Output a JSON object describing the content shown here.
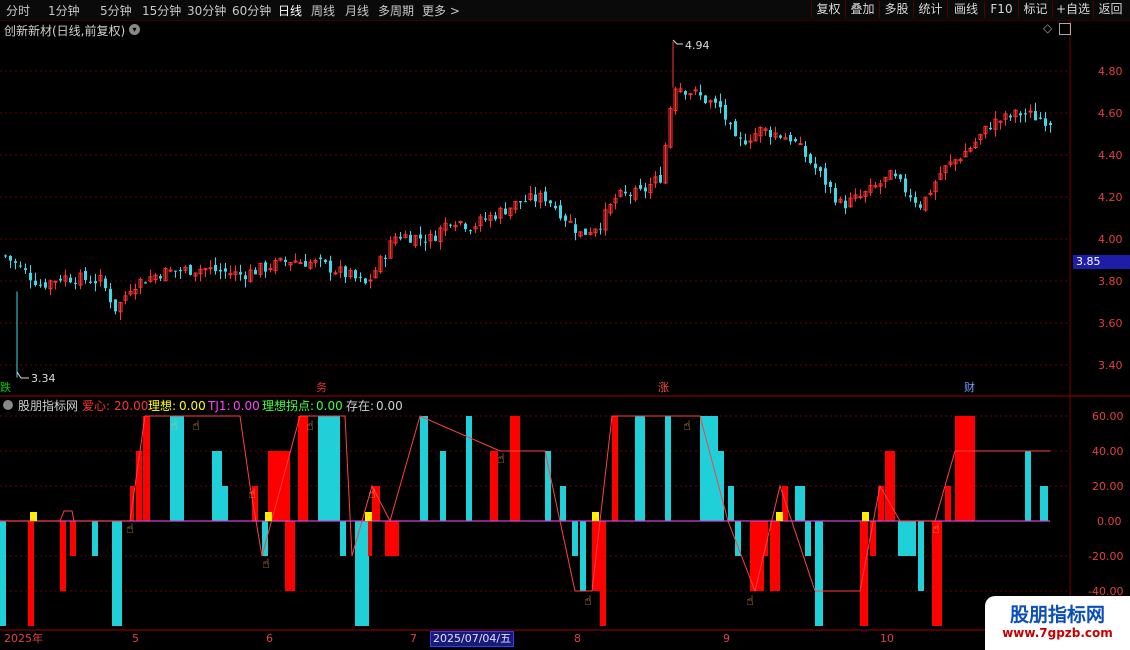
{
  "top_menu": {
    "periods": [
      "分时",
      "1分钟",
      "5分钟",
      "15分钟",
      "30分钟",
      "60分钟",
      "日线",
      "周线",
      "月线",
      "多周期",
      "更多 >"
    ],
    "active_period": "日线",
    "right_buttons": [
      "复权",
      "叠加",
      "多股",
      "统计",
      "画线",
      "F10",
      "标记",
      "+自选",
      "返回"
    ]
  },
  "main_chart": {
    "title": "创新新材(日线,前复权)",
    "high_label": "4.94",
    "low_label": "3.34",
    "current_price_badge": "3.85",
    "y_ticks": [
      "4.80",
      "4.60",
      "4.40",
      "4.20",
      "4.00",
      "3.80",
      "3.60",
      "3.40"
    ],
    "event_markers": [
      {
        "text": "跌",
        "color": "#00d000"
      },
      {
        "text": "务",
        "color": "#e03030"
      },
      {
        "text": "涨",
        "color": "#ff5050"
      },
      {
        "text": "财",
        "color": "#6fa0ff"
      }
    ],
    "colors": {
      "up": "#ff3232",
      "down": "#3ed8e8"
    }
  },
  "indicator": {
    "name": "股朋指标网",
    "legend": [
      {
        "label": "爱心:",
        "value": "20.00",
        "color": "#ff3030"
      },
      {
        "label": "理想:",
        "value": "0.00",
        "color": "#ffff00"
      },
      {
        "label": "TJ1:",
        "value": "0.00",
        "color": "#ff40ff"
      },
      {
        "label": "理想拐点:",
        "value": "0.00",
        "color": "#40ff40"
      },
      {
        "label": "存在:",
        "value": "0.00",
        "color": "#d0d0d0"
      }
    ],
    "y_ticks": [
      "60.00",
      "40.00",
      "20.00",
      "0.00",
      "-20.00",
      "-40.00"
    ],
    "colors": {
      "red": "#ff0000",
      "cyan": "#1fd0d8",
      "line": "#d040d0"
    }
  },
  "x_axis": {
    "labels": [
      "2025年",
      "5",
      "6",
      "7",
      "8",
      "9",
      "10"
    ],
    "selected_date": "2025/07/04/五"
  },
  "watermark": {
    "title": "股朋指标网",
    "url": "www.7gpzb.com"
  }
}
